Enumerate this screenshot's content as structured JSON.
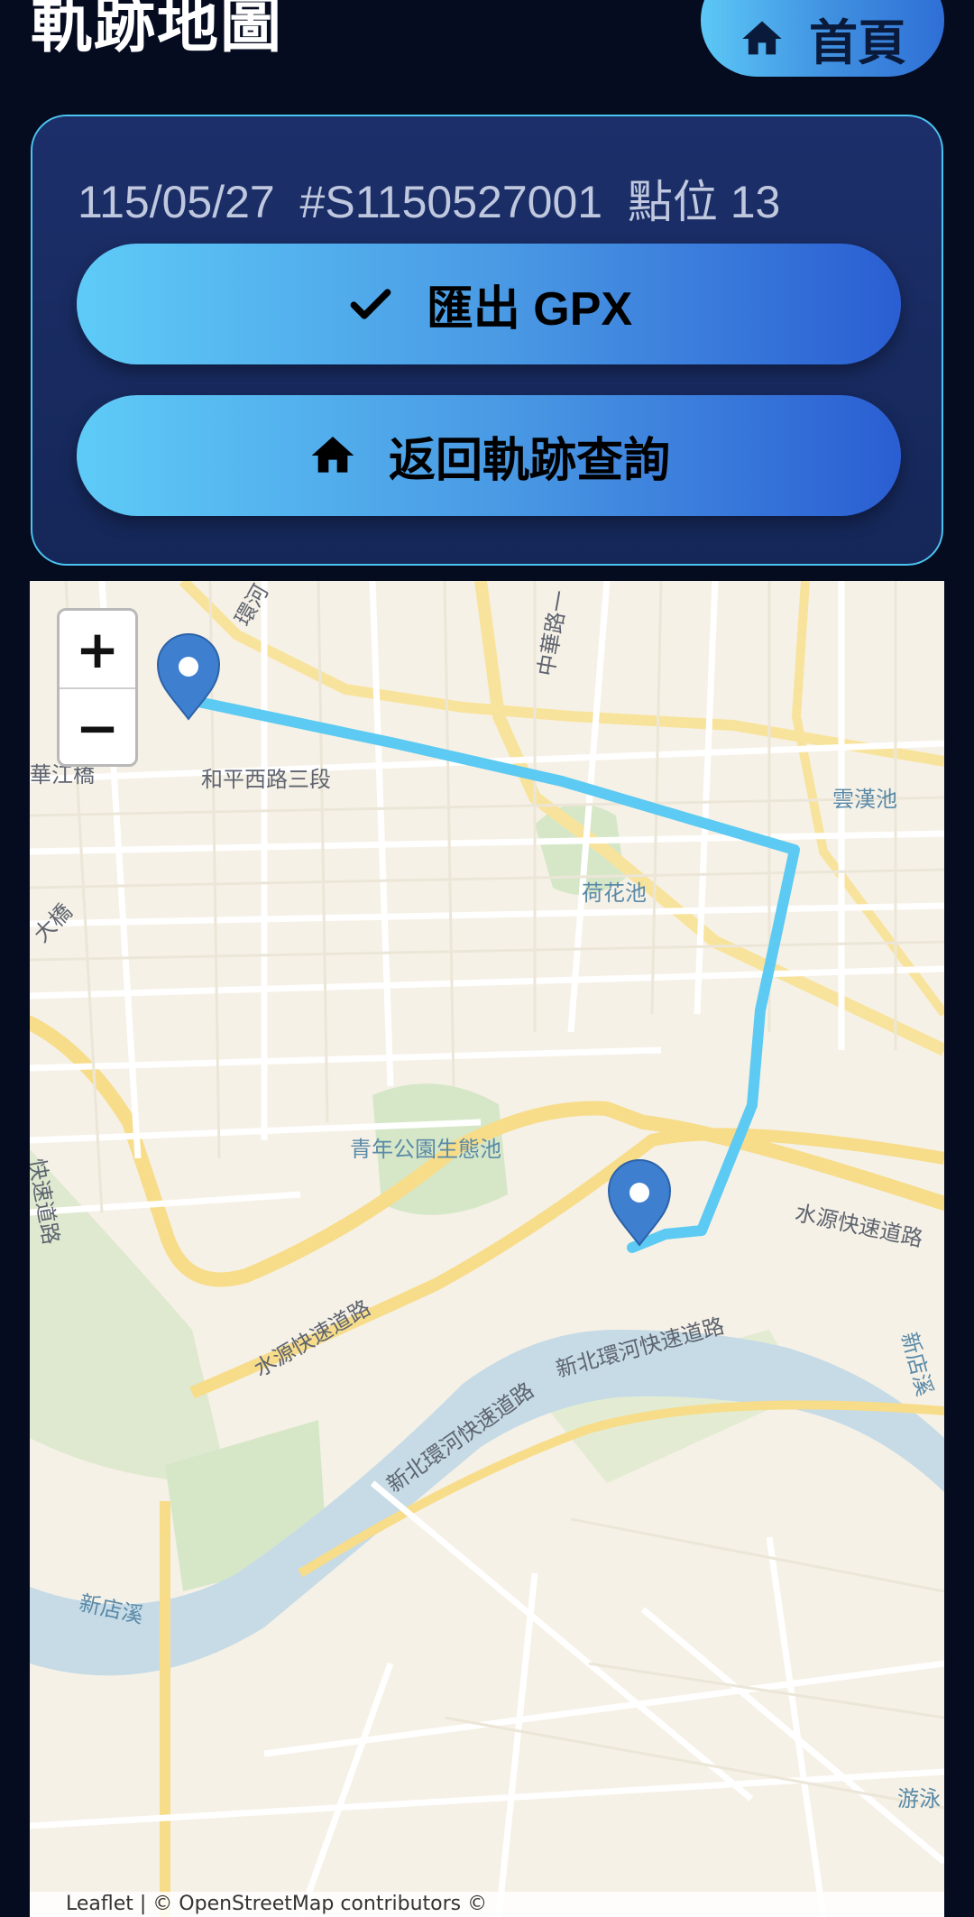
{
  "header": {
    "title": "軌跡地圖",
    "home_label": "首頁"
  },
  "summary": {
    "date": "115/05/27",
    "id": "#S1150527001",
    "points": "點位 13"
  },
  "actions": {
    "export_label": "匯出 GPX",
    "back_label": "返回軌跡查詢"
  },
  "map": {
    "zoom_in": "+",
    "zoom_out": "−",
    "labels": [
      "環河",
      "中華路一",
      "和平西路三段",
      "華江橋",
      "雲漢池",
      "荷花池",
      "大橋",
      "青年公園生態池",
      "水源快速道路",
      "快速道路",
      "水源快速道路",
      "新北環河快速道路",
      "新北環河快速道路",
      "新店溪",
      "新店溪",
      "游泳"
    ],
    "attribution": "Leaflet | © OpenStreetMap contributors ©",
    "route_color": "#5ccaf2",
    "marker_color": "#3f7fcf"
  }
}
